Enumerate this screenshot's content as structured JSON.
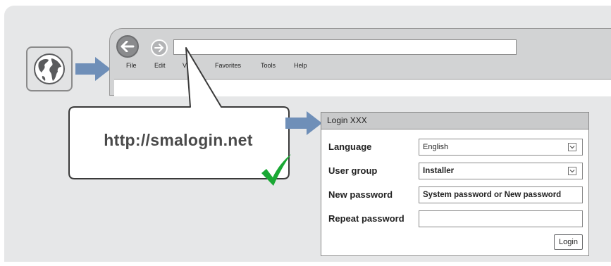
{
  "browser": {
    "menu": [
      "File",
      "Edit",
      "View",
      "Favorites",
      "Tools",
      "Help"
    ],
    "address_value": ""
  },
  "callout": {
    "url": "http://smalogin.net"
  },
  "dialog": {
    "title": "Login XXX",
    "rows": [
      {
        "label": "Language",
        "value": "English",
        "type": "select"
      },
      {
        "label": "User group",
        "value": "Installer",
        "type": "select"
      },
      {
        "label": "New password",
        "value": "System password or New password",
        "type": "input"
      },
      {
        "label": "Repeat password",
        "value": "",
        "type": "input"
      }
    ],
    "login_label": "Login"
  },
  "colors": {
    "arrow": "#6f8fb8",
    "check": "#1aa834",
    "panel": "#e6e7e8"
  },
  "icons": [
    "globe-icon",
    "back-arrow-icon",
    "forward-arrow-icon",
    "checkmark-icon",
    "chevron-down-icon"
  ]
}
